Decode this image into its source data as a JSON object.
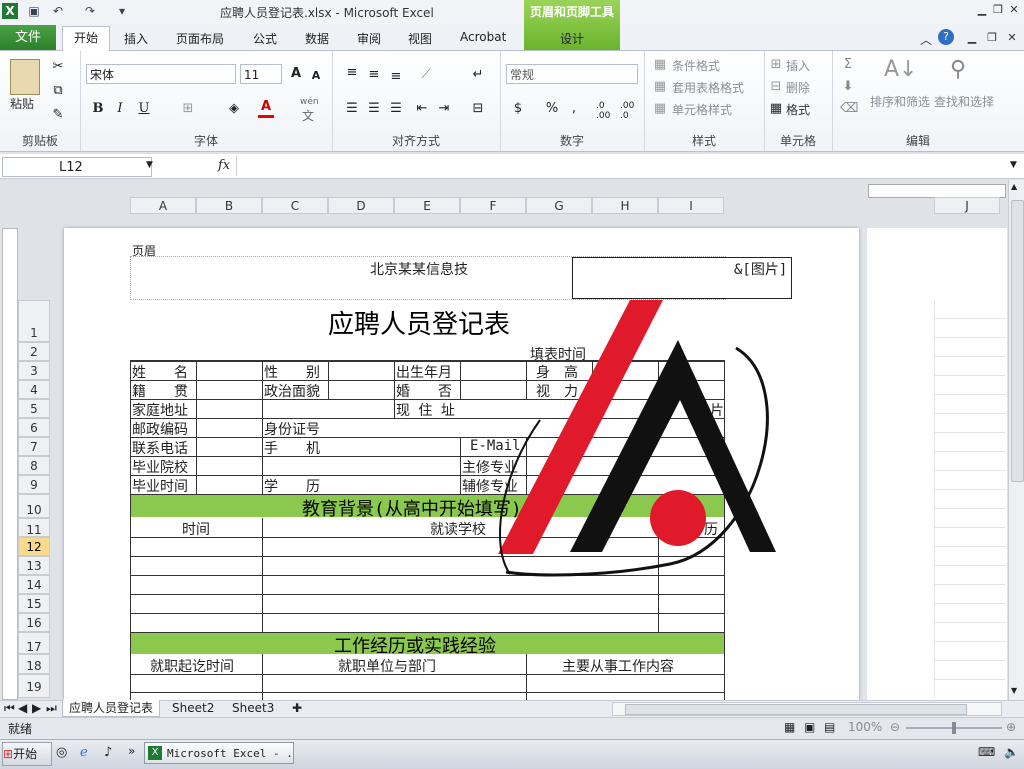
{
  "window": {
    "title": "应聘人员登记表.xlsx  -  Microsoft Excel",
    "context_tool_title": "页眉和页脚工具",
    "context_tab": "设计"
  },
  "tabs": [
    "文件",
    "开始",
    "插入",
    "页面布局",
    "公式",
    "数据",
    "审阅",
    "视图",
    "Acrobat"
  ],
  "ribbon": {
    "clipboard": {
      "label": "剪贴板",
      "paste": "粘贴"
    },
    "font": {
      "label": "字体",
      "name": "宋体",
      "size": "11",
      "bold": "B",
      "italic": "I",
      "underline": "U",
      "font_color_glyph": "A",
      "wen": "wén",
      "wen_char": "文"
    },
    "alignment": {
      "label": "对齐方式"
    },
    "number": {
      "label": "数字",
      "format": "常规",
      "percent": "%",
      "comma": ",",
      "inc": ".0 .00",
      "dec": ".00 .0"
    },
    "styles": {
      "label": "样式",
      "cond": "条件格式",
      "table": "套用表格格式",
      "cell": "单元格样式"
    },
    "cells": {
      "label": "单元格",
      "insert": "插入",
      "delete": "删除",
      "format": "格式"
    },
    "editing": {
      "label": "编辑",
      "sort": "排序和筛选",
      "find": "查找和选择"
    }
  },
  "formula_bar": {
    "name_box": "L12",
    "fx": "fx",
    "formula": ""
  },
  "columns": [
    "A",
    "B",
    "C",
    "D",
    "E",
    "F",
    "G",
    "H",
    "I",
    "J"
  ],
  "rows": [
    "1",
    "2",
    "3",
    "4",
    "5",
    "6",
    "7",
    "8",
    "9",
    "10",
    "11",
    "12",
    "13",
    "14",
    "15",
    "16",
    "17",
    "18",
    "19"
  ],
  "header": {
    "label": "页眉",
    "center": "北京某某信息技",
    "right": "&[图片]"
  },
  "form": {
    "title": "应聘人员登记表",
    "fill_time": "填表时间",
    "name": "姓　　名",
    "gender": "性　　别",
    "birth": "出生年月",
    "height": "身　高",
    "native": "籍　　贯",
    "political": "政治面貌",
    "marriage": "婚　　否",
    "vision": "视　力",
    "home": "家庭地址",
    "current": "现 住 址",
    "photo": "片",
    "postcode": "邮政编码",
    "idcard": "身份证号",
    "phone": "联系电话",
    "mobile": "手　　机",
    "email": "E-Mail",
    "school": "毕业院校",
    "major": "主修专业",
    "gradtime": "毕业时间",
    "degree": "学　　历",
    "minor": "辅修专业",
    "edu_section": "教育背景(从高中开始填写)",
    "edu_time": "时间",
    "edu_school": "就读学校",
    "edu_degree": "学　　历",
    "work_section": "工作经历或实践经验",
    "work_time": "就职起讫时间",
    "work_unit": "就职单位与部门",
    "work_content": "主要从事工作内容"
  },
  "sheets": [
    "应聘人员登记表",
    "Sheet2",
    "Sheet3"
  ],
  "status": {
    "mode": "就绪",
    "zoom": "100%"
  },
  "taskbar": {
    "start": "开始",
    "window": "Microsoft Excel - ..."
  },
  "colors": {
    "accent": "#2d7f2a",
    "section_green": "#8bc94e",
    "logo_red": "#e0192b",
    "logo_black": "#111111"
  }
}
